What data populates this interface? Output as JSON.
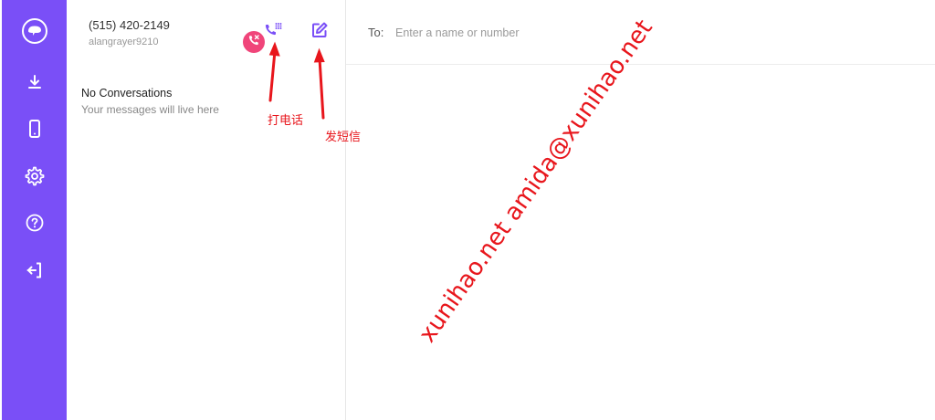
{
  "account": {
    "phone": "(515) 420-2149",
    "username": "alangrayer9210"
  },
  "conversations": {
    "empty_title": "No Conversations",
    "empty_subtitle": "Your messages will live here"
  },
  "compose": {
    "to_label": "To:",
    "placeholder": "Enter a name or number"
  },
  "annotations": {
    "call_label": "打电话",
    "message_label": "发短信"
  },
  "watermark": "xunihao.net amida@xunihao.net",
  "nav": {
    "items": [
      "logo-icon",
      "download-icon",
      "phone-device-icon",
      "settings-icon",
      "help-icon",
      "logout-icon"
    ]
  },
  "colors": {
    "rail": "#7a4ff7",
    "accent": "#7a4ff7",
    "missed_badge": "#f0457a",
    "annotation": "#e8161c"
  }
}
